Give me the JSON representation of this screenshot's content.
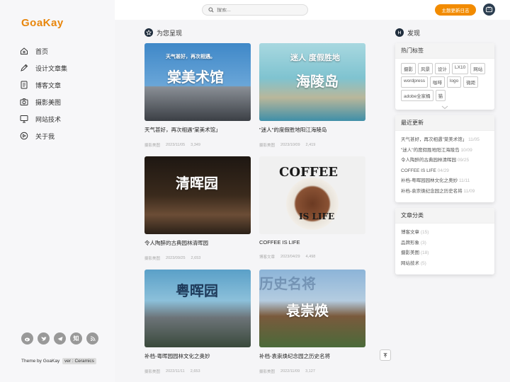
{
  "brand": {
    "logo": "GoaKay"
  },
  "nav": [
    {
      "label": "首页",
      "icon": "home-icon"
    },
    {
      "label": "设计文章集",
      "icon": "pen-icon"
    },
    {
      "label": "博客文章",
      "icon": "document-icon"
    },
    {
      "label": "摄影美图",
      "icon": "camera-icon"
    },
    {
      "label": "网站技术",
      "icon": "monitor-icon"
    },
    {
      "label": "关于我",
      "icon": "info-icon"
    }
  ],
  "socials": [
    "weibo-icon",
    "twitter-icon",
    "telegram-icon",
    "zhihu-icon",
    "rss-icon"
  ],
  "social_labels": {
    "zhihu": "知"
  },
  "footer": {
    "theme_text": "Theme by GoaKay",
    "version": "ver : Ceramics"
  },
  "topbar": {
    "search_placeholder": "搜索...",
    "update_button": "主题更新日志"
  },
  "main": {
    "section_title": "为您呈现"
  },
  "cards": [
    {
      "title": "天气甚好，再次相遇\"棠美术馆」",
      "category": "摄影美图",
      "date": "2023/11/05",
      "views": "3,349",
      "overlay": "棠美术馆",
      "overlay_small": "天气甚好，再次相遇。",
      "bg": "#4a8fc8"
    },
    {
      "title": "\"迷人\"的度假胜地阳江海陵岛",
      "category": "摄影美图",
      "date": "2023/10/09",
      "views": "2,419",
      "overlay": "海陵岛",
      "overlay_small": "迷人 度假胜地",
      "bg": "#8fc9d6"
    },
    {
      "title": "令人陶醉的古典园林清晖园",
      "category": "摄影美图",
      "date": "2023/09/25",
      "views": "2,653",
      "overlay": "清晖园",
      "overlay_small": "",
      "bg": "#2a1f18"
    },
    {
      "title": "COFFEE IS LIFE",
      "category": "博客文章",
      "date": "2023/04/29",
      "views": "4,498",
      "overlay": "COFFEE",
      "overlay_small": "IS LIFE",
      "bg": "#efefef"
    },
    {
      "title": "补档-粤晖园园林文化之奥妙",
      "category": "摄影美图",
      "date": "2022/11/11",
      "views": "2,653",
      "overlay": "粤晖园",
      "overlay_small": "",
      "bg": "#6aa7c9"
    },
    {
      "title": "补档-袁崇焕纪念园之历史名将",
      "category": "摄影美图",
      "date": "2022/11/09",
      "views": "3,127",
      "overlay": "袁崇焕",
      "overlay_small": "历史名将",
      "bg": "#8fb6d8"
    }
  ],
  "right": {
    "section_title": "发现",
    "tags_title": "热门标签",
    "tags": [
      "摄影",
      "风景",
      "设计",
      "LX10",
      "网站",
      "wordpress",
      "咖啡",
      "logo",
      "微距",
      "adobe全家桶",
      "猫"
    ],
    "recent_title": "最近更新",
    "recent": [
      {
        "title": "天气甚好，再次相遇\"棠美术馆」",
        "date": "11/05"
      },
      {
        "title": "\"迷人\"的度假胜地阳江海陵岛",
        "date": "10/09"
      },
      {
        "title": "令人陶醉的古典园林清晖园",
        "date": "09/25"
      },
      {
        "title": "COFFEE IS LIFE",
        "date": "04/29"
      },
      {
        "title": "补档-粤晖园园林文化之奥妙",
        "date": "11/11"
      },
      {
        "title": "补档-袁崇焕纪念园之历史名将",
        "date": "11/09"
      }
    ],
    "cats_title": "文章分类",
    "cats": [
      {
        "name": "博客文章",
        "count": "(15)"
      },
      {
        "name": "品牌形象",
        "count": "(3)"
      },
      {
        "name": "摄影美图",
        "count": "(18)"
      },
      {
        "name": "网站技术",
        "count": "(5)"
      }
    ]
  },
  "colors": {
    "accent": "#e8860c",
    "button": "#f28b00"
  }
}
